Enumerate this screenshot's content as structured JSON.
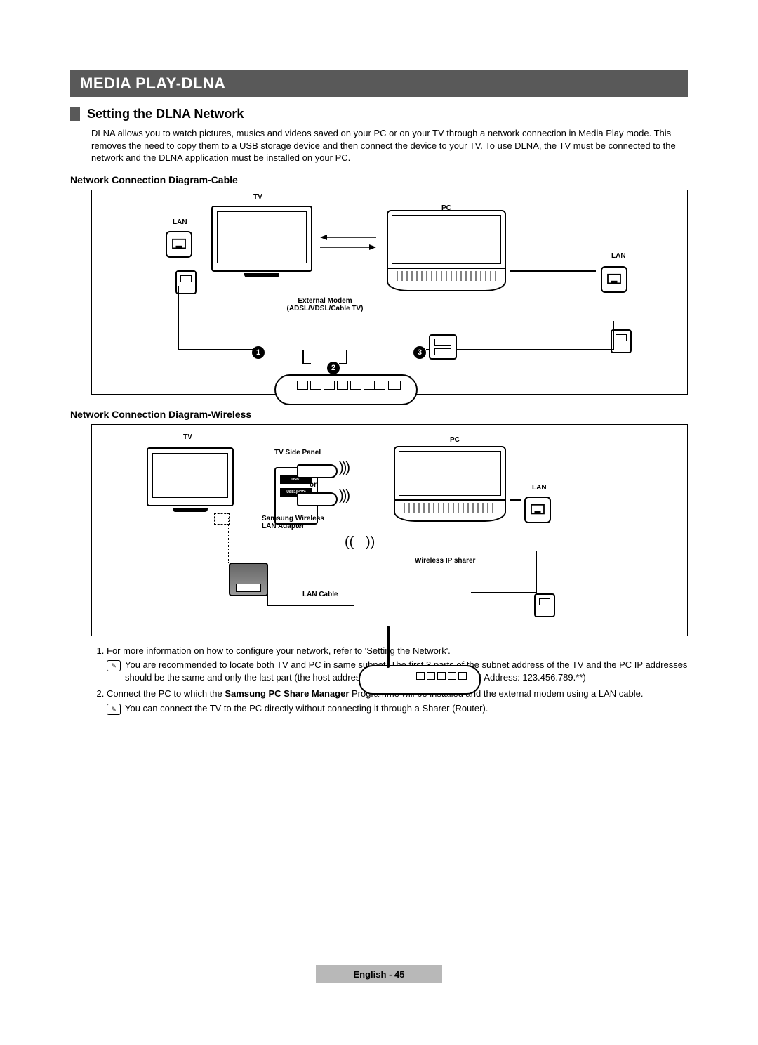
{
  "banner": "MEDIA PLAY-DLNA",
  "section_heading": "Setting the DLNA Network",
  "intro": "DLNA allows you to watch pictures, musics and videos saved on your PC or on your TV through a network connection in Media Play mode. This removes the need to copy them to a USB storage device and then connect the device to your TV. To use DLNA, the TV must be connected to the network and the DLNA application must be installed on your PC.",
  "diagram1": {
    "heading": "Network Connection Diagram-Cable",
    "labels": {
      "tv": "TV",
      "lan_tv": "LAN",
      "pc": "PC",
      "lan_pc": "LAN",
      "modem_line1": "External Modem",
      "modem_line2": "(ADSL/VDSL/Cable TV)"
    },
    "callouts": {
      "c1": "1",
      "c2": "2",
      "c3": "3"
    }
  },
  "diagram2": {
    "heading": "Network Connection Diagram-Wireless",
    "labels": {
      "tv": "TV",
      "pc": "PC",
      "lan_pc": "LAN",
      "side_panel": "TV Side Panel",
      "or": "or",
      "adapter_line1": "Samsung Wireless",
      "adapter_line2": "LAN Adapter",
      "router": "Wireless IP sharer",
      "usb1": "USB1",
      "usb2": "USB1(HDD)",
      "lan_cable": "LAN Cable"
    }
  },
  "notes": {
    "item1_text": "For more information on how to configure your network, refer to 'Setting the Network'.",
    "item1_sub": "You are recommended to locate both TV and PC in same subnet. The first 3 parts of the subnet address of the TV and the PC IP addresses should be the same and only the last part (the host address) should be changed. (e.g. IP Address: 123.456.789.**)",
    "item2_prefix": "Connect the PC to which the ",
    "item2_bold": "Samsung PC Share Manager",
    "item2_suffix": " Programme will be installed and the external modem using a LAN cable.",
    "item2_sub": "You can connect the TV to the PC directly without connecting it through a Sharer (Router)."
  },
  "footer": {
    "lang": "English",
    "page": "45"
  }
}
